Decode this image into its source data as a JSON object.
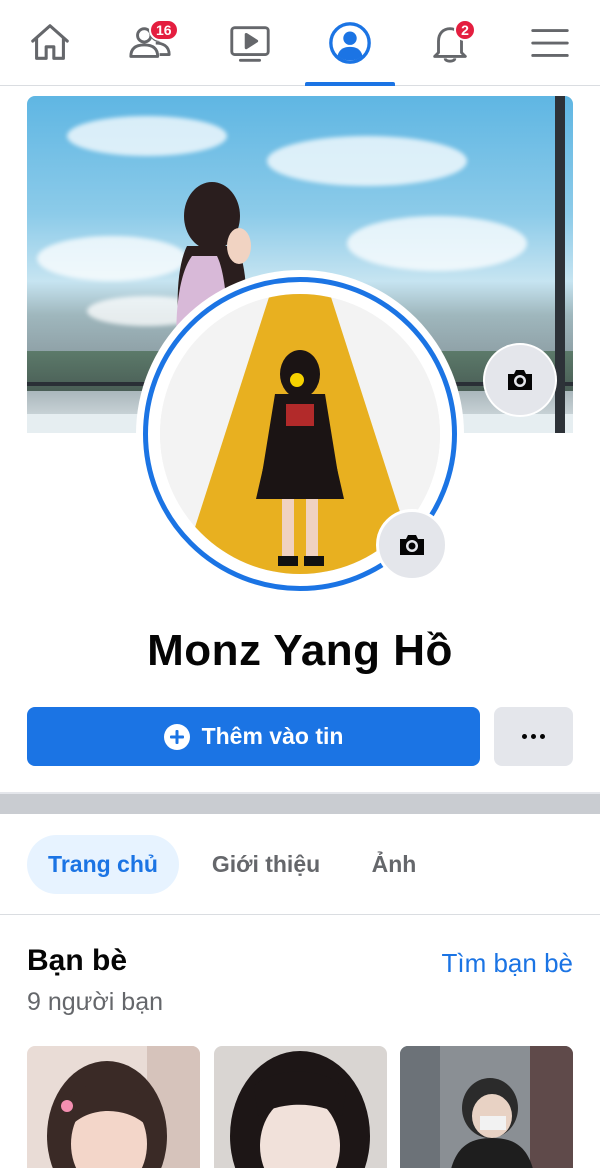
{
  "nav": {
    "items": [
      {
        "name": "home",
        "icon": "home-icon",
        "badge": ""
      },
      {
        "name": "friends",
        "icon": "friends-icon",
        "badge": "16"
      },
      {
        "name": "watch",
        "icon": "video-icon",
        "badge": ""
      },
      {
        "name": "profile",
        "icon": "profile-icon",
        "badge": "",
        "active": true
      },
      {
        "name": "notifications",
        "icon": "bell-icon",
        "badge": "2"
      },
      {
        "name": "menu",
        "icon": "menu-icon",
        "badge": ""
      }
    ]
  },
  "profile": {
    "name": "Monz Yang Hồ"
  },
  "actions": {
    "add_story_label": "Thêm vào tin",
    "more_label": "..."
  },
  "tabs": [
    "Trang chủ",
    "Giới thiệu",
    "Ảnh"
  ],
  "friends": {
    "title": "Bạn bè",
    "find_label": "Tìm bạn bè",
    "count_label": "9 người bạn"
  },
  "colors": {
    "accent": "#1b74e4",
    "badge": "#e41e3f",
    "tab_active_bg": "#e7f3ff",
    "button_gray": "#e4e6eb",
    "divider": "#c9ccd1"
  }
}
